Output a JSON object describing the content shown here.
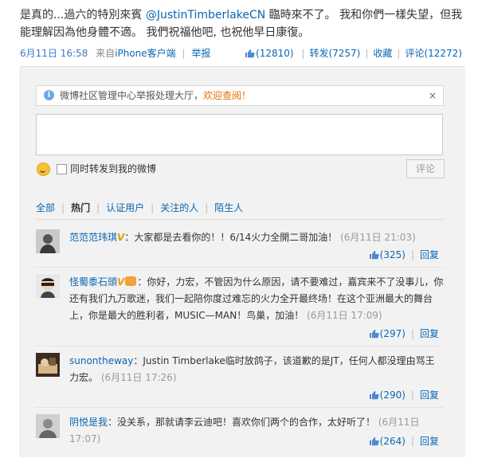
{
  "post": {
    "text_before": "是真的...過六的特別來賓 ",
    "mention": "@JustinTimberlakeCN",
    "text_after": " 臨時來不了。 我和你們一樣失望，但我能理解因為他身體不適。 我們祝福他吧, 也祝他早日康復。",
    "time": "6月11日 16:58",
    "source_prefix": "来自",
    "source": "iPhone客户端",
    "report": "举报",
    "likes": "(12810)",
    "repost": "转发(7257)",
    "favorite": "收藏",
    "comment": "评论(12272)"
  },
  "notice": {
    "text": "微博社区管理中心举报处理大厅，",
    "link": "欢迎查阅！",
    "close": "×"
  },
  "composer": {
    "repost_label": "同时转发到我的微博",
    "submit_label": "评论"
  },
  "filters": [
    "全部",
    "热门",
    "认证用户",
    "关注的人",
    "陌生人"
  ],
  "comments": [
    {
      "user": "范范范玮琪",
      "badge": "V",
      "text": "：大家都是去看你的！！6/14火力全開二哥加油！",
      "time": "(6月11日 21:03)",
      "likes": "(325)",
      "reply": "回复"
    },
    {
      "user": "怪蜀黍石頭",
      "badge": "V",
      "text": "：你好，力宏，不管因为什么原因，请不要难过，嘉宾来不了没事儿，你还有我们九万歌迷，我们一起陪你度过难忘的火力全开最终场！在这个亚洲最大的舞台上，你是最大的胜利者，MUSIC—MAN！鸟巢，加油！",
      "time": "(6月11日 17:09)",
      "likes": "(297)",
      "reply": "回复"
    },
    {
      "user": "sunontheway",
      "badge": "",
      "text": "：Justin Timberlake临时放鸽子，该道歉的是JT，任何人都没理由骂王力宏。",
      "time": "(6月11日 17:26)",
      "likes": "(290)",
      "reply": "回复"
    },
    {
      "user": "阴悦是我",
      "badge": "",
      "text": "：没关系，那就请李云迪吧！喜欢你们两个的合作，太好听了！",
      "time": "(6月11日 17:07)",
      "likes": "(264)",
      "reply": "回复"
    }
  ],
  "colors": {
    "link": "#0a66b2",
    "panel": "#f2f2f2",
    "notice_link": "#e46d00"
  }
}
